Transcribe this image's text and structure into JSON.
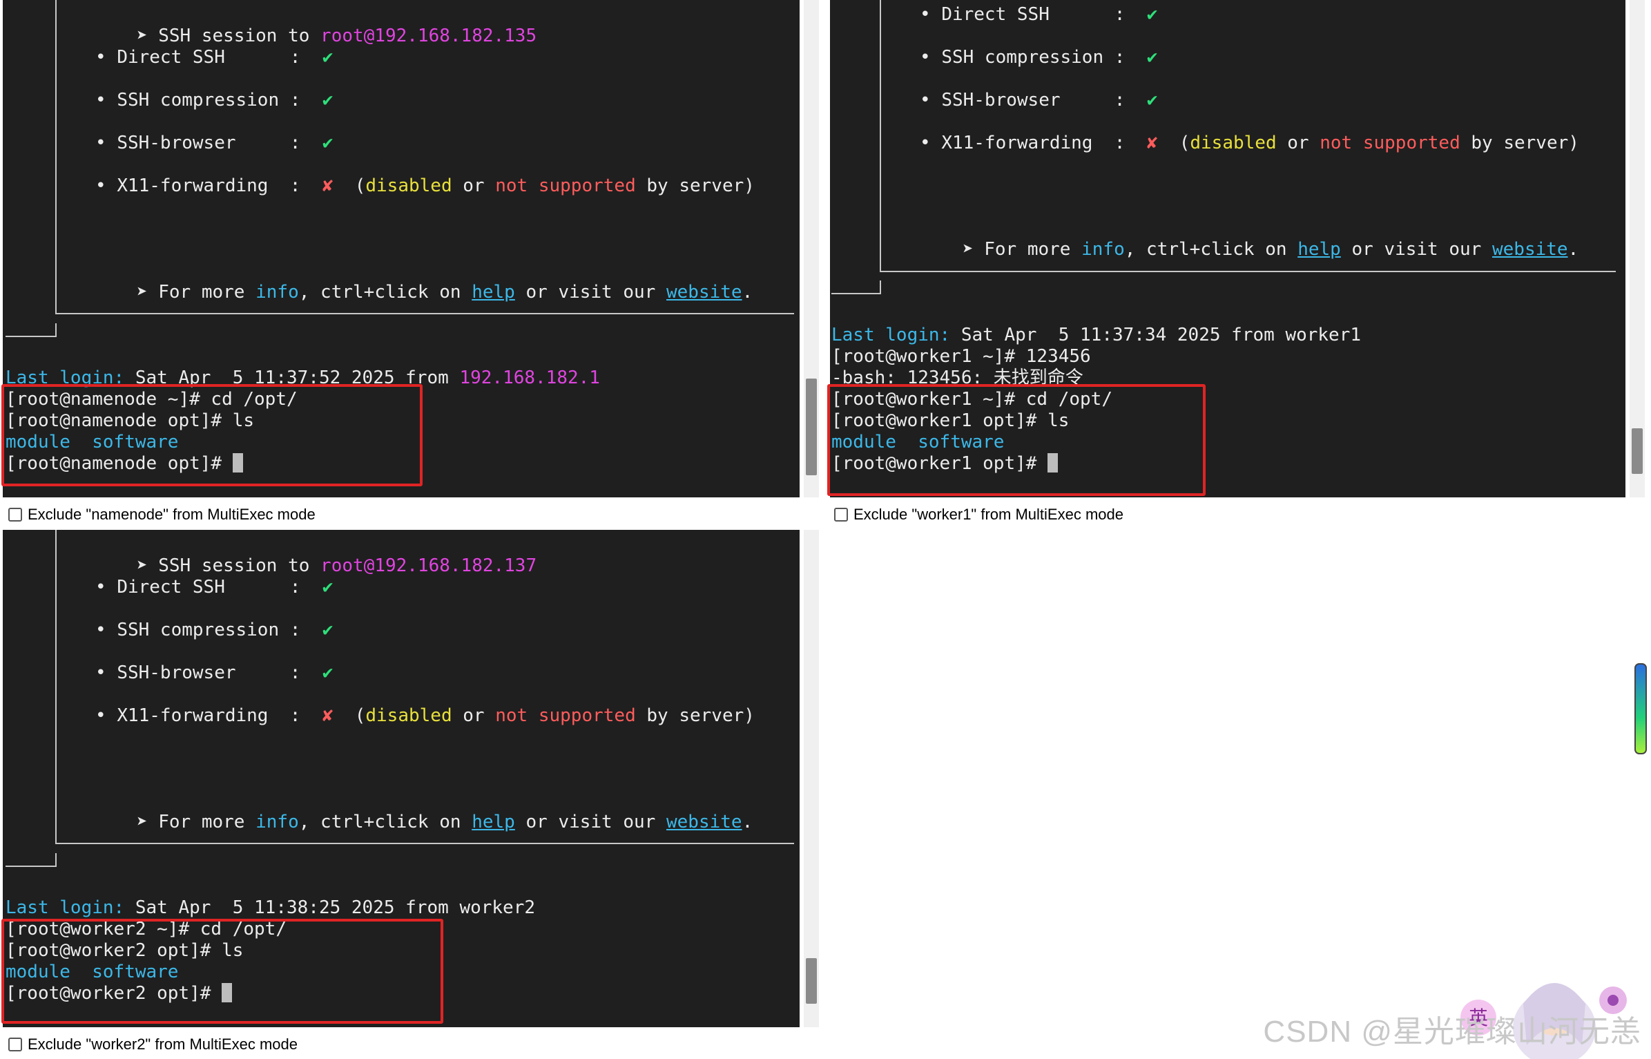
{
  "panes": [
    {
      "id": "namenode",
      "session_prefix": "SSH session to ",
      "session_target": "root@192.168.182.135",
      "features": [
        {
          "name": "Direct SSH     ",
          "status": "✔"
        },
        {
          "name": "SSH compression",
          "status": "✔"
        },
        {
          "name": "SSH-browser    ",
          "status": "✔"
        },
        {
          "name": "X11-forwarding ",
          "status": "✘"
        }
      ],
      "x11_note": {
        "open": "(",
        "disabled": "disabled",
        "or": " or ",
        "not_supported": "not supported",
        "by_server": " by server)"
      },
      "more_info": {
        "prefix": "For more ",
        "info": "info",
        "mid": ", ctrl+click on ",
        "help": "help",
        "mid2": " or visit our ",
        "website": "website",
        "end": "."
      },
      "last_login_label": "Last login:",
      "last_login_text": " Sat Apr  5 11:37:52 2025 from ",
      "last_login_host": "192.168.182.1",
      "extra_lines": [],
      "cmd1": "[root@namenode ~]# cd /opt/",
      "cmd2": "[root@namenode opt]# ls",
      "ls_module": "module",
      "ls_software": "software",
      "prompt": "[root@namenode opt]# ",
      "exclude_label": "Exclude \"namenode\" from MultiExec mode"
    },
    {
      "id": "worker1",
      "features": [
        {
          "name": "Direct SSH     ",
          "status": "✔"
        },
        {
          "name": "SSH compression",
          "status": "✔"
        },
        {
          "name": "SSH-browser    ",
          "status": "✔"
        },
        {
          "name": "X11-forwarding ",
          "status": "✘"
        }
      ],
      "x11_note": {
        "open": "(",
        "disabled": "disabled",
        "or": " or ",
        "not_supported": "not supported",
        "by_server": " by server)"
      },
      "more_info": {
        "prefix": "For more ",
        "info": "info",
        "mid": ", ctrl+click on ",
        "help": "help",
        "mid2": " or visit our ",
        "website": "website",
        "end": "."
      },
      "last_login_label": "Last login:",
      "last_login_text": " Sat Apr  5 11:37:34 2025 from worker1",
      "extra_lines": [
        "[root@worker1 ~]# 123456",
        "-bash: 123456: 未找到命令"
      ],
      "cmd1": "[root@worker1 ~]# cd /opt/",
      "cmd2": "[root@worker1 opt]# ls",
      "ls_module": "module",
      "ls_software": "software",
      "prompt": "[root@worker1 opt]# ",
      "exclude_label": "Exclude \"worker1\" from MultiExec mode"
    },
    {
      "id": "worker2",
      "session_prefix": "SSH session to ",
      "session_target": "root@192.168.182.137",
      "features": [
        {
          "name": "Direct SSH     ",
          "status": "✔"
        },
        {
          "name": "SSH compression",
          "status": "✔"
        },
        {
          "name": "SSH-browser    ",
          "status": "✔"
        },
        {
          "name": "X11-forwarding ",
          "status": "✘"
        }
      ],
      "x11_note": {
        "open": "(",
        "disabled": "disabled",
        "or": " or ",
        "not_supported": "not supported",
        "by_server": " by server)"
      },
      "more_info": {
        "prefix": "For more ",
        "info": "info",
        "mid": ", ctrl+click on ",
        "help": "help",
        "mid2": " or visit our ",
        "website": "website",
        "end": "."
      },
      "last_login_label": "Last login:",
      "last_login_text": " Sat Apr  5 11:38:25 2025 from worker2",
      "extra_lines": [],
      "cmd1": "[root@worker2 ~]# cd /opt/",
      "cmd2": "[root@worker2 opt]# ls",
      "ls_module": "module",
      "ls_software": "software",
      "prompt": "[root@worker2 opt]# ",
      "exclude_label": "Exclude \"worker2\" from MultiExec mode"
    }
  ],
  "common": {
    "bullet": "•",
    "colon": ":",
    "arrow": "➤"
  },
  "watermark": "CSDN @星光璀璨山河无恙",
  "ime_badge": "英",
  "colors": {
    "terminal_bg": "#1f1f1f",
    "magenta": "#e044e0",
    "cyan": "#3cb8e8",
    "yellow": "#e8e03c",
    "red": "#ff5c5c",
    "green": "#2ee07a",
    "highlight_box": "#e02424"
  }
}
